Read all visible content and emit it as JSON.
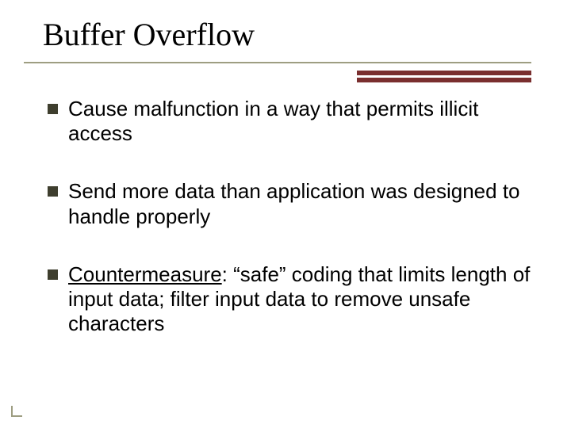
{
  "title": "Buffer Overflow",
  "bullets": [
    {
      "text": "Cause malfunction in a way that permits illicit access"
    },
    {
      "text": "Send more data than application was designed to handle properly"
    },
    {
      "label": "Countermeasure",
      "text": ": “safe” coding that limits length of input data; filter input data to remove unsafe characters"
    }
  ]
}
